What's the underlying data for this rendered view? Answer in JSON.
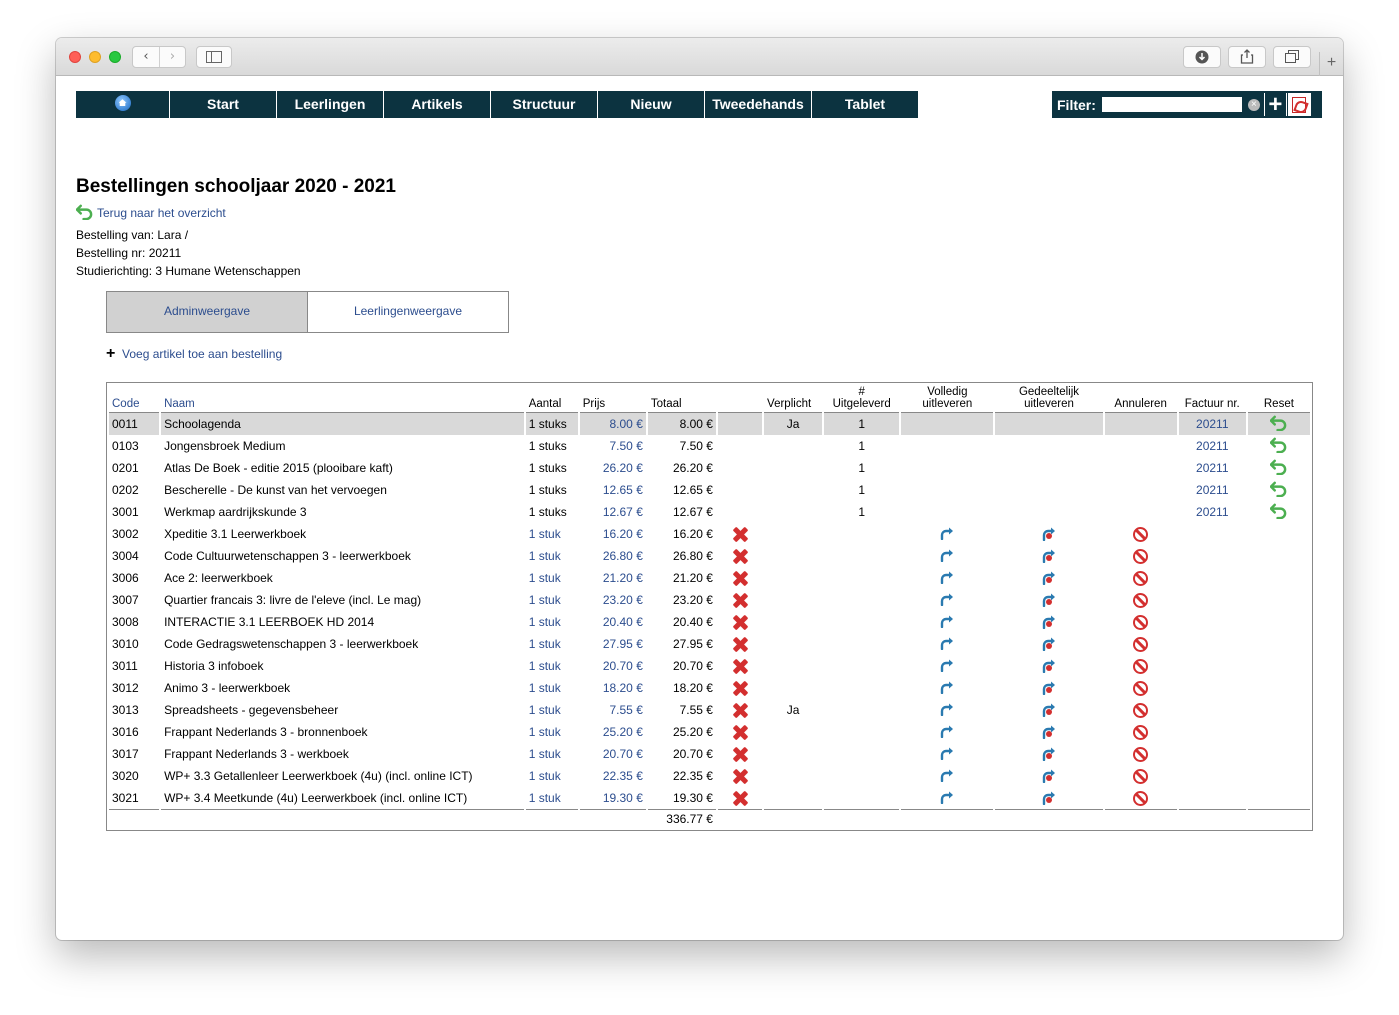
{
  "nav": {
    "items": [
      {
        "label": ""
      },
      {
        "label": "Start"
      },
      {
        "label": "Leerlingen"
      },
      {
        "label": "Artikels"
      },
      {
        "label": "Structuur"
      },
      {
        "label": "Nieuw"
      },
      {
        "label": "Tweedehands"
      },
      {
        "label": "Tablet"
      }
    ]
  },
  "filter": {
    "label": "Filter:",
    "value": ""
  },
  "page": {
    "title": "Bestellingen schooljaar 2020 - 2021",
    "back_link": "Terug naar het overzicht",
    "info": [
      "Bestelling van: Lara /",
      "Bestelling nr: 20211",
      "Studierichting: 3 Humane Wetenschappen"
    ]
  },
  "tabs": [
    {
      "label": "Adminweergave",
      "active": true
    },
    {
      "label": "Leerlingenweergave",
      "active": false
    }
  ],
  "add_article": "Voeg artikel toe aan bestelling",
  "table": {
    "headers": {
      "code": "Code",
      "naam": "Naam",
      "aantal": "Aantal",
      "prijs": "Prijs",
      "totaal": "Totaal",
      "verplicht": "Verplicht",
      "uitgeleverd_1": "#",
      "uitgeleverd_2": "Uitgeleverd",
      "volledig_1": "Volledig",
      "volledig_2": "uitleveren",
      "gedeeltelijk_1": "Gedeeltelijk",
      "gedeeltelijk_2": "uitleveren",
      "annuleren": "Annuleren",
      "factuur": "Factuur nr.",
      "reset": "Reset"
    },
    "rows": [
      {
        "code": "0011",
        "naam": "Schoolagenda",
        "aantal": "1 stuks",
        "prijs": "8.00 €",
        "totaal": "8.00 €",
        "verplicht": "Ja",
        "uitgeleverd": "1",
        "factuur": "20211",
        "delivered": true,
        "highlight": true
      },
      {
        "code": "0103",
        "naam": "Jongensbroek Medium",
        "aantal": "1 stuks",
        "prijs": "7.50 €",
        "totaal": "7.50 €",
        "verplicht": "",
        "uitgeleverd": "1",
        "factuur": "20211",
        "delivered": true
      },
      {
        "code": "0201",
        "naam": "Atlas De Boek - editie 2015 (plooibare kaft)",
        "aantal": "1 stuks",
        "prijs": "26.20 €",
        "totaal": "26.20 €",
        "verplicht": "",
        "uitgeleverd": "1",
        "factuur": "20211",
        "delivered": true
      },
      {
        "code": "0202",
        "naam": "Bescherelle - De kunst van het vervoegen",
        "aantal": "1 stuks",
        "prijs": "12.65 €",
        "totaal": "12.65 €",
        "verplicht": "",
        "uitgeleverd": "1",
        "factuur": "20211",
        "delivered": true
      },
      {
        "code": "3001",
        "naam": "Werkmap aardrijkskunde 3",
        "aantal": "1 stuks",
        "prijs": "12.67 €",
        "totaal": "12.67 €",
        "verplicht": "",
        "uitgeleverd": "1",
        "factuur": "20211",
        "delivered": true
      },
      {
        "code": "3002",
        "naam": "Xpeditie 3.1 Leerwerkboek",
        "aantal": "1 stuk",
        "prijs": "16.20 €",
        "totaal": "16.20 €",
        "verplicht": "",
        "uitgeleverd": "",
        "factuur": "",
        "delivered": false
      },
      {
        "code": "3004",
        "naam": "Code Cultuurwetenschappen 3 - leerwerkboek",
        "aantal": "1 stuk",
        "prijs": "26.80 €",
        "totaal": "26.80 €",
        "verplicht": "",
        "uitgeleverd": "",
        "factuur": "",
        "delivered": false
      },
      {
        "code": "3006",
        "naam": "Ace 2: leerwerkboek",
        "aantal": "1 stuk",
        "prijs": "21.20 €",
        "totaal": "21.20 €",
        "verplicht": "",
        "uitgeleverd": "",
        "factuur": "",
        "delivered": false
      },
      {
        "code": "3007",
        "naam": "Quartier francais 3: livre de l'eleve (incl. Le mag)",
        "aantal": "1 stuk",
        "prijs": "23.20 €",
        "totaal": "23.20 €",
        "verplicht": "",
        "uitgeleverd": "",
        "factuur": "",
        "delivered": false
      },
      {
        "code": "3008",
        "naam": "INTERACTIE 3.1 LEERBOEK HD 2014",
        "aantal": "1 stuk",
        "prijs": "20.40 €",
        "totaal": "20.40 €",
        "verplicht": "",
        "uitgeleverd": "",
        "factuur": "",
        "delivered": false
      },
      {
        "code": "3010",
        "naam": "Code Gedragswetenschappen 3 - leerwerkboek",
        "aantal": "1 stuk",
        "prijs": "27.95 €",
        "totaal": "27.95 €",
        "verplicht": "",
        "uitgeleverd": "",
        "factuur": "",
        "delivered": false
      },
      {
        "code": "3011",
        "naam": "Historia 3 infoboek",
        "aantal": "1 stuk",
        "prijs": "20.70 €",
        "totaal": "20.70 €",
        "verplicht": "",
        "uitgeleverd": "",
        "factuur": "",
        "delivered": false
      },
      {
        "code": "3012",
        "naam": "Animo 3 - leerwerkboek",
        "aantal": "1 stuk",
        "prijs": "18.20 €",
        "totaal": "18.20 €",
        "verplicht": "",
        "uitgeleverd": "",
        "factuur": "",
        "delivered": false
      },
      {
        "code": "3013",
        "naam": "Spreadsheets - gegevensbeheer",
        "aantal": "1 stuk",
        "prijs": "7.55 €",
        "totaal": "7.55 €",
        "verplicht": "Ja",
        "uitgeleverd": "",
        "factuur": "",
        "delivered": false
      },
      {
        "code": "3016",
        "naam": "Frappant Nederlands 3 - bronnenboek",
        "aantal": "1 stuk",
        "prijs": "25.20 €",
        "totaal": "25.20 €",
        "verplicht": "",
        "uitgeleverd": "",
        "factuur": "",
        "delivered": false
      },
      {
        "code": "3017",
        "naam": "Frappant Nederlands 3 - werkboek",
        "aantal": "1 stuk",
        "prijs": "20.70 €",
        "totaal": "20.70 €",
        "verplicht": "",
        "uitgeleverd": "",
        "factuur": "",
        "delivered": false
      },
      {
        "code": "3020",
        "naam": "WP+ 3.3 Getallenleer Leerwerkboek (4u) (incl. online ICT)",
        "aantal": "1 stuk",
        "prijs": "22.35 €",
        "totaal": "22.35 €",
        "verplicht": "",
        "uitgeleverd": "",
        "factuur": "",
        "delivered": false
      },
      {
        "code": "3021",
        "naam": "WP+ 3.4 Meetkunde (4u) Leerwerkboek (incl. online ICT)",
        "aantal": "1 stuk",
        "prijs": "19.30 €",
        "totaal": "19.30 €",
        "verplicht": "",
        "uitgeleverd": "",
        "factuur": "",
        "delivered": false
      }
    ],
    "grand_total": "336.77 €"
  },
  "colors": {
    "nav_bg": "#0c3340",
    "link": "#2c4d8e",
    "highlight_row": "#d9d9d9",
    "delete_red": "#d32f2f",
    "reset_green": "#4caf50",
    "deliver_blue": "#2a7ab0"
  }
}
